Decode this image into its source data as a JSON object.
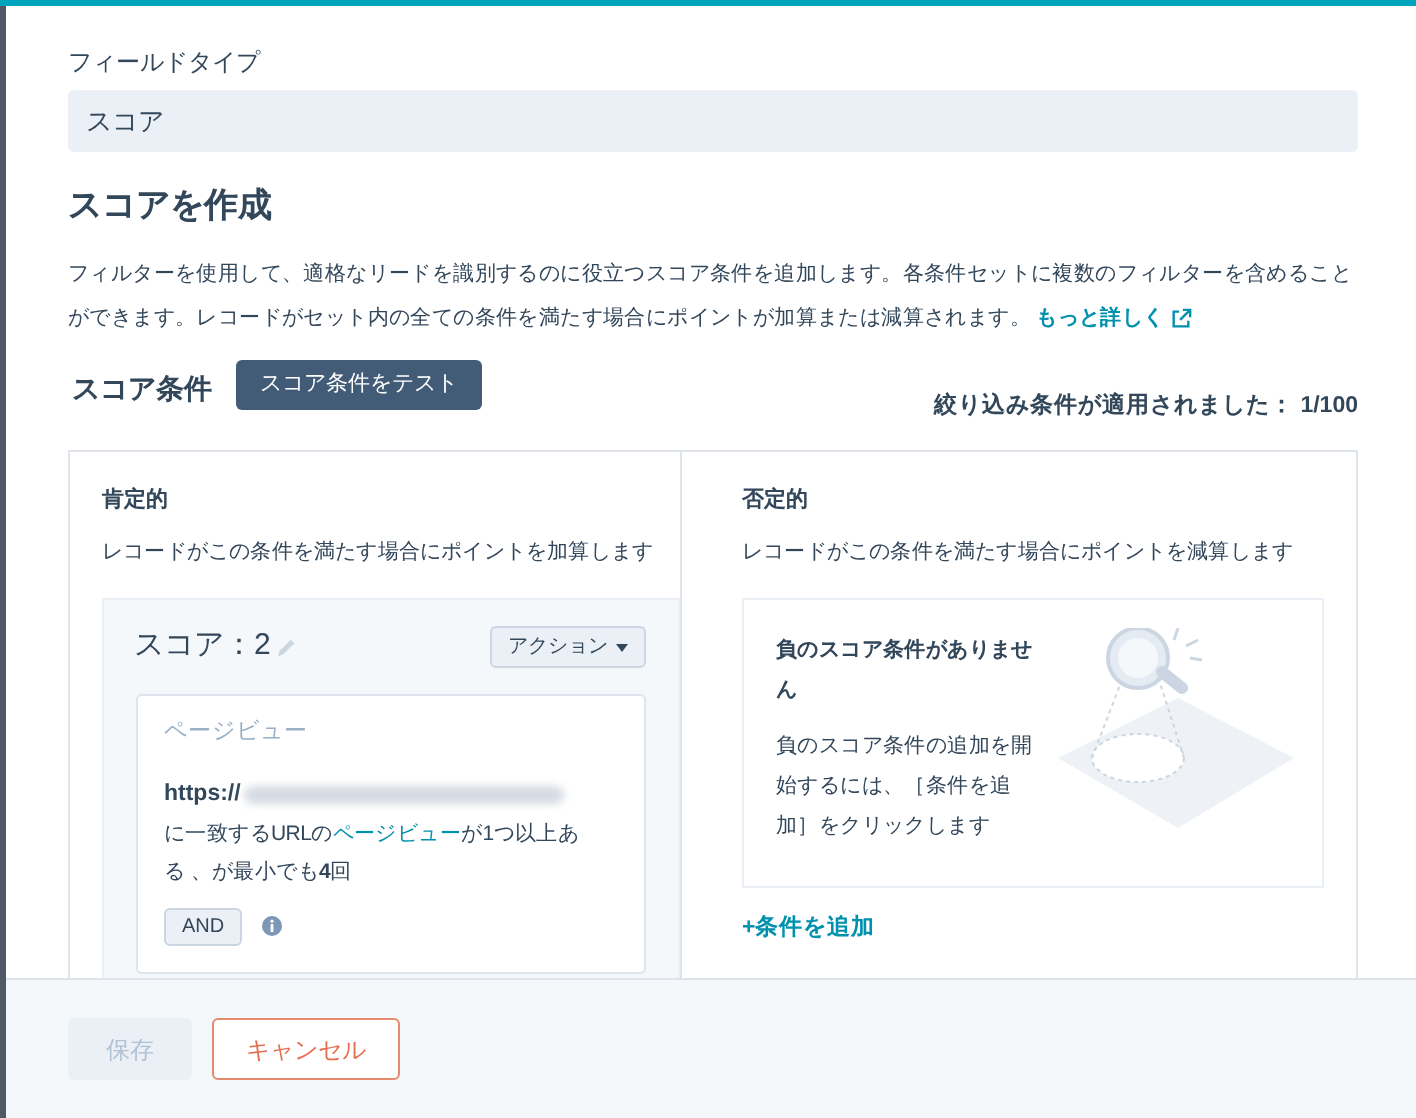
{
  "field_type": {
    "label": "フィールドタイプ",
    "value": "スコア"
  },
  "heading": "スコアを作成",
  "description": "フィルターを使用して、適格なリードを識別するのに役立つスコア条件を追加します。各条件セットに複数のフィルターを含めることができます。レコードがセット内の全ての条件を満たす場合にポイントが加算または減算されます。",
  "learn_more": "もっと詳しく",
  "score_conditions": {
    "label": "スコア条件",
    "test_button": "スコア条件をテスト",
    "applied": "絞り込み条件が適用されました： 1/100"
  },
  "positive": {
    "title": "肯定的",
    "description": "レコードがこの条件を満たす場合にポイントを加算します",
    "score_sets": [
      {
        "score": "スコア：2",
        "actions_button": "アクション",
        "filter": {
          "type": "ページビュー",
          "url": "https://",
          "text_before": "に一致するURLの",
          "link": "ページビュー",
          "text_after": "が1つ以上ある 、が最小でも**4**回",
          "and_button": "AND"
        }
      }
    ]
  },
  "negative": {
    "title": "否定的",
    "description": "レコードがこの条件を満たす場合にポイントを減算します",
    "empty_title": "負のスコア条件がありません",
    "empty_text": "負のスコア条件の追加を開始するには、［条件を追加］をクリックします",
    "add_link": "+条件を追加"
  },
  "footer": {
    "buttons": [
      {
        "label": "保存",
        "disabled": true,
        "kind": "primary"
      },
      {
        "label": "キャンセル",
        "disabled": false,
        "kind": "secondary"
      }
    ]
  }
}
